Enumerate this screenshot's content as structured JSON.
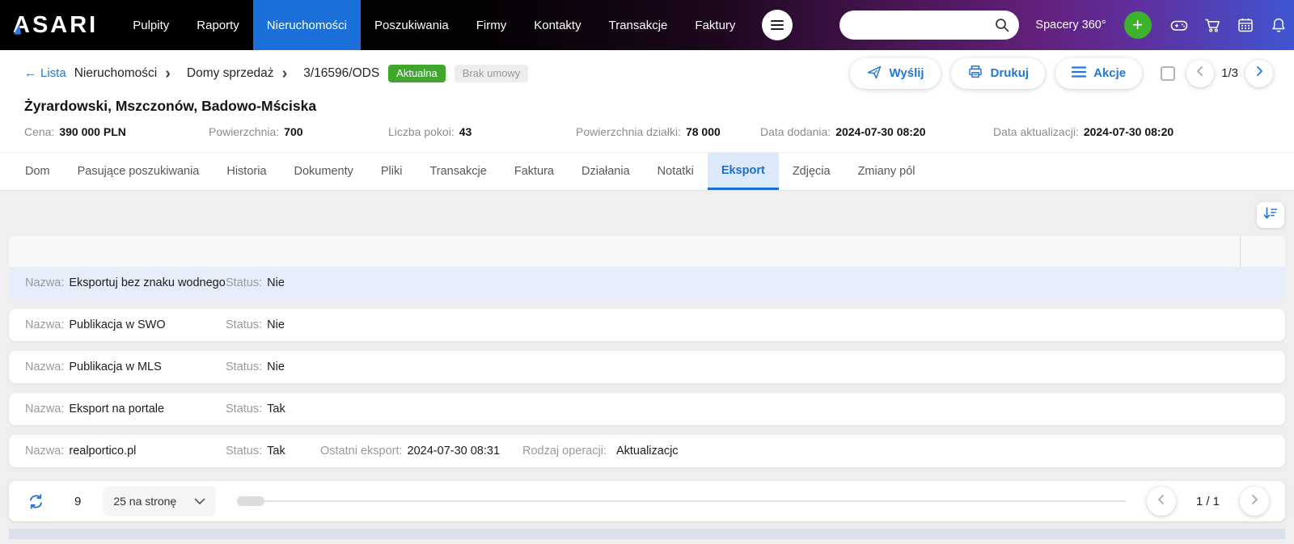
{
  "navbar": {
    "logo": "ASARI",
    "items": [
      "Pulpity",
      "Raporty",
      "Nieruchomości",
      "Poszukiwania",
      "Firmy",
      "Kontakty",
      "Transakcje",
      "Faktury"
    ],
    "active_item": "Nieruchomości",
    "search_value": "",
    "spacery_label": "Spacery 360°",
    "plus_glyph": "+"
  },
  "breadcrumb": {
    "back_arrow": "←",
    "back_label": "Lista",
    "crumbs": [
      "Nieruchomości",
      "Domy sprzedaż",
      "3/16596/ODS"
    ],
    "separator": "›",
    "status_badge": "Aktualna",
    "contract_badge": "Brak umowy",
    "buttons": {
      "send": "Wyślij",
      "print": "Drukuj",
      "actions": "Akcje"
    },
    "page_indicator": "1/3"
  },
  "property": {
    "title": "Żyrardowski, Mszczonów, Badowo-Mściska",
    "fields": [
      {
        "label": "Cena:",
        "value": "390 000 PLN"
      },
      {
        "label": "Powierzchnia:",
        "value": "700"
      },
      {
        "label": "Liczba pokoi:",
        "value": "43"
      },
      {
        "label": "Powierzchnia działki:",
        "value": "78 000"
      },
      {
        "label": "Data dodania:",
        "value": "2024-07-30 08:20"
      },
      {
        "label": "Data aktualizacji:",
        "value": "2024-07-30 08:20"
      }
    ]
  },
  "tabs": {
    "items": [
      "Dom",
      "Pasujące poszukiwania",
      "Historia",
      "Dokumenty",
      "Pliki",
      "Transakcje",
      "Faktura",
      "Działania",
      "Notatki",
      "Eksport",
      "Zdjęcia",
      "Zmiany pól"
    ],
    "active": "Eksport"
  },
  "export_table": {
    "labels": {
      "name": "Nazwa:",
      "status": "Status:",
      "last_export": "Ostatni eksport:",
      "operation": "Rodzaj operacji:"
    },
    "rows": [
      {
        "name": "Eksportuj bez znaku wodnego",
        "status": "Nie"
      },
      {
        "name": "Publikacja w SWO",
        "status": "Nie"
      },
      {
        "name": "Publikacja w MLS",
        "status": "Nie"
      },
      {
        "name": "Eksport na portale",
        "status": "Tak"
      },
      {
        "name": "realportico.pl",
        "status": "Tak",
        "last_export": "2024-07-30 08:31",
        "operation": "Aktualizacjc"
      }
    ]
  },
  "footer": {
    "count": "9",
    "per_page": "25 na stronę",
    "page_indicator": "1 / 1"
  },
  "colors": {
    "nav_active_blue": "#1b6fd8",
    "accent_blue": "#2478d4",
    "badge_green": "#3fa72c",
    "plus_green": "#3cb32a",
    "tab_active_bg": "#dceafb",
    "row_highlight": "#e7edfb"
  }
}
